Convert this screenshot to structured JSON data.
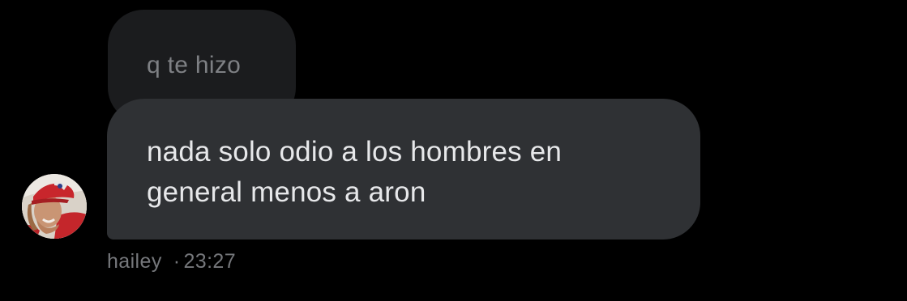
{
  "messages": [
    {
      "text": "q te hizo",
      "style": "faded"
    },
    {
      "text": "nada solo odio a los hombres en\ngeneral menos a aron"
    }
  ],
  "sender": {
    "name": "hailey",
    "time": "23:27",
    "separator": "·"
  },
  "colors": {
    "background": "#000000",
    "bubble_faded": "#1b1c1e",
    "bubble": "#2f3134",
    "text_primary": "#e7e8ea",
    "text_muted": "#75777b"
  }
}
